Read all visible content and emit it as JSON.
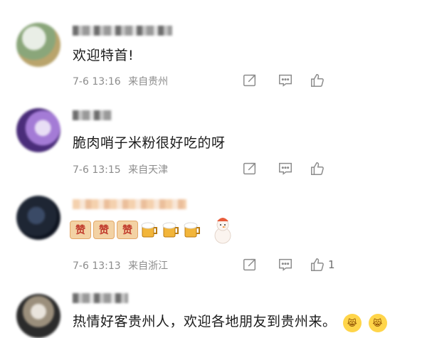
{
  "comments": [
    {
      "text": "欢迎特首!",
      "date": "7-6 13:16",
      "location": "来自贵州",
      "like_count": "",
      "avatar_colors": [
        "#c9d6c8",
        "#6f8f5d",
        "#b9a46c"
      ]
    },
    {
      "text": "脆肉哨子米粉很好吃的呀",
      "date": "7-6 13:15",
      "location": "来自天津",
      "like_count": "",
      "avatar_colors": [
        "#d7c5ea",
        "#4a2d7a",
        "#a47bd6"
      ]
    },
    {
      "text": "",
      "date": "7-6 13:13",
      "location": "来自浙江",
      "like_count": "1",
      "avatar_colors": [
        "#1e2634",
        "#3a4a66",
        "#0e1420"
      ],
      "emoji_row": {
        "zan_labels": [
          "赞",
          "赞",
          "赞"
        ],
        "beer_count": 3,
        "snowman": "snowman-sticker"
      }
    },
    {
      "text": "热情好客贵州人，欢迎各地朋友到贵州来。",
      "date": "",
      "location": "",
      "like_count": "",
      "avatar_colors": [
        "#e9e4dc",
        "#2b2b2b",
        "#9b8f7c"
      ]
    }
  ],
  "icons": {
    "share": "share-icon",
    "comment": "comment-icon",
    "like": "thumbs-up-icon"
  },
  "colors": {
    "meta_gray": "#8c8c8c",
    "text": "#1b1b1b"
  }
}
